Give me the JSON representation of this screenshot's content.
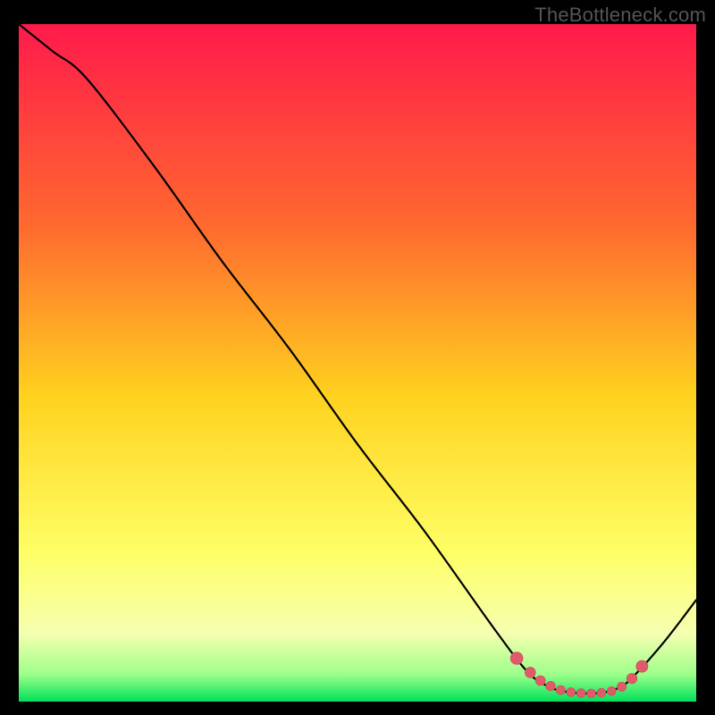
{
  "attribution": "TheBottleneck.com",
  "colors": {
    "curve": "#000000",
    "marker_fill": "#e05a6a",
    "marker_stroke": "#c94a5a",
    "frame_bg": "#000000"
  },
  "chart_data": {
    "type": "line",
    "title": "",
    "xlabel": "",
    "ylabel": "",
    "xlim": [
      0,
      100
    ],
    "ylim": [
      0,
      100
    ],
    "gradient_stops": [
      {
        "offset": 0,
        "color": "#ff1a4b"
      },
      {
        "offset": 30,
        "color": "#ff6a2f"
      },
      {
        "offset": 55,
        "color": "#ffd21f"
      },
      {
        "offset": 78,
        "color": "#ffff66"
      },
      {
        "offset": 90,
        "color": "#f5ffb0"
      },
      {
        "offset": 96,
        "color": "#9dff8a"
      },
      {
        "offset": 100,
        "color": "#00e05a"
      }
    ],
    "series": [
      {
        "name": "bottleneck-curve",
        "x": [
          0,
          5,
          10,
          20,
          30,
          40,
          50,
          60,
          70,
          75,
          78,
          80,
          82,
          84,
          86,
          88,
          90,
          95,
          100
        ],
        "values": [
          100,
          96,
          92,
          79,
          65,
          52,
          38,
          25,
          11,
          4.5,
          2.3,
          1.6,
          1.3,
          1.2,
          1.3,
          1.8,
          3.0,
          8.5,
          15
        ]
      }
    ],
    "markers": {
      "name": "optimal-zone",
      "x": [
        73.5,
        75.5,
        77.0,
        78.5,
        80.0,
        81.5,
        83.0,
        84.5,
        86.0,
        87.5,
        89.0,
        90.5,
        92.0
      ],
      "values": [
        6.4,
        4.3,
        3.1,
        2.3,
        1.7,
        1.4,
        1.25,
        1.2,
        1.3,
        1.55,
        2.2,
        3.4,
        5.2
      ],
      "r": [
        7,
        6,
        5.5,
        5.3,
        5.1,
        5.0,
        5.0,
        5.0,
        5.0,
        5.0,
        5.2,
        5.8,
        6.6
      ]
    }
  }
}
